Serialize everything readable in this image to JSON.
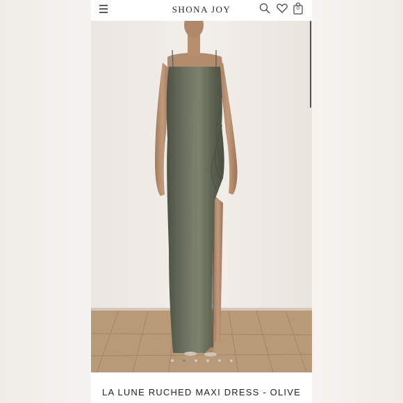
{
  "header": {
    "brand": "SHONA JOY",
    "menu_icon": "hamburger-menu-icon",
    "search_icon": "search-icon",
    "wishlist_icon": "heart-icon",
    "bag_icon": "shopping-bag-icon",
    "bag_count": "0"
  },
  "gallery": {
    "image_subject": "model wearing olive satin maxi dress",
    "slide_count": 6,
    "active_slide": 2
  },
  "product": {
    "title": "LA LUNE RUCHED MAXI DRESS - OLIVE"
  },
  "colors": {
    "dress": "#5f6553",
    "wall": "#ece8e3",
    "floor": "#b99a78"
  }
}
